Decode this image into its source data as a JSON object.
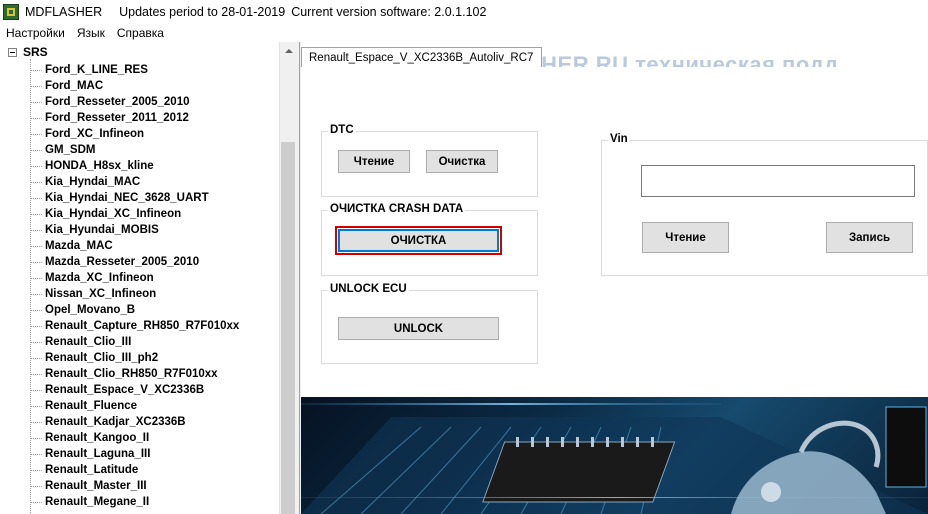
{
  "window": {
    "app_name": "MDFLASHER",
    "updates": "Updates period to 28-01-2019",
    "version": "Current version software: 2.0.1.102"
  },
  "menu": [
    "Настройки",
    "Язык",
    "Справка"
  ],
  "tree": {
    "root": "SRS",
    "items": [
      "Ford_K_LINE_RES",
      "Ford_MAC",
      "Ford_Resseter_2005_2010",
      "Ford_Resseter_2011_2012",
      "Ford_XC_Infineon",
      "GM_SDM",
      "HONDA_H8sx_kline",
      "Kia_Hyndai_MAC",
      "Kia_Hyndai_NEC_3628_UART",
      "Kia_Hyndai_XC_Infineon",
      "Kia_Hyundai_MOBIS",
      "Mazda_MAC",
      "Mazda_Resseter_2005_2010",
      "Mazda_XC_Infineon",
      "Nissan_XC_Infineon",
      "Opel_Movano_B",
      "Renault_Capture_RH850_R7F010xx",
      "Renault_Clio_III",
      "Renault_Clio_III_ph2",
      "Renault_Clio_RH850_R7F010xx",
      "Renault_Espace_V_XC2336B",
      "Renault_Fluence",
      "Renault_Kadjar_XC2336B",
      "Renault_Kangoo_II",
      "Renault_Laguna_III",
      "Renault_Latitude",
      "Renault_Master_III",
      "Renault_Megane_II"
    ]
  },
  "banner": {
    "watermark": "SHER.RU техническая подд"
  },
  "tab": {
    "label": "Renault_Espace_V_XC2336B_Autoliv_RC7"
  },
  "dtc": {
    "title": "DTC",
    "read_label": "Чтение",
    "clear_label": "Очистка"
  },
  "crash": {
    "title": "ОЧИСТКА CRASH DATA",
    "clear_label": "ОЧИСТКА"
  },
  "unlock": {
    "title": "UNLOCK ECU",
    "button_label": "UNLOCK"
  },
  "vin": {
    "title": "Vin",
    "value": "",
    "read_label": "Чтение",
    "write_label": "Запись"
  },
  "colors": {
    "highlight": "#d10000",
    "focus": "#0078d7"
  }
}
